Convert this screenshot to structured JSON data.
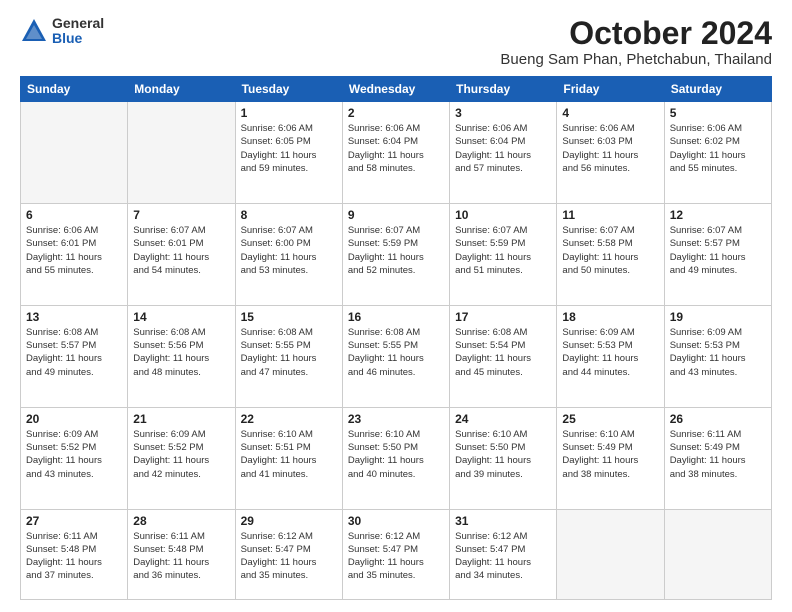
{
  "logo": {
    "general": "General",
    "blue": "Blue"
  },
  "header": {
    "month_title": "October 2024",
    "location": "Bueng Sam Phan, Phetchabun, Thailand"
  },
  "weekdays": [
    "Sunday",
    "Monday",
    "Tuesday",
    "Wednesday",
    "Thursday",
    "Friday",
    "Saturday"
  ],
  "weeks": [
    [
      {
        "day": "",
        "info": ""
      },
      {
        "day": "",
        "info": ""
      },
      {
        "day": "1",
        "info": "Sunrise: 6:06 AM\nSunset: 6:05 PM\nDaylight: 11 hours\nand 59 minutes."
      },
      {
        "day": "2",
        "info": "Sunrise: 6:06 AM\nSunset: 6:04 PM\nDaylight: 11 hours\nand 58 minutes."
      },
      {
        "day": "3",
        "info": "Sunrise: 6:06 AM\nSunset: 6:04 PM\nDaylight: 11 hours\nand 57 minutes."
      },
      {
        "day": "4",
        "info": "Sunrise: 6:06 AM\nSunset: 6:03 PM\nDaylight: 11 hours\nand 56 minutes."
      },
      {
        "day": "5",
        "info": "Sunrise: 6:06 AM\nSunset: 6:02 PM\nDaylight: 11 hours\nand 55 minutes."
      }
    ],
    [
      {
        "day": "6",
        "info": "Sunrise: 6:06 AM\nSunset: 6:01 PM\nDaylight: 11 hours\nand 55 minutes."
      },
      {
        "day": "7",
        "info": "Sunrise: 6:07 AM\nSunset: 6:01 PM\nDaylight: 11 hours\nand 54 minutes."
      },
      {
        "day": "8",
        "info": "Sunrise: 6:07 AM\nSunset: 6:00 PM\nDaylight: 11 hours\nand 53 minutes."
      },
      {
        "day": "9",
        "info": "Sunrise: 6:07 AM\nSunset: 5:59 PM\nDaylight: 11 hours\nand 52 minutes."
      },
      {
        "day": "10",
        "info": "Sunrise: 6:07 AM\nSunset: 5:59 PM\nDaylight: 11 hours\nand 51 minutes."
      },
      {
        "day": "11",
        "info": "Sunrise: 6:07 AM\nSunset: 5:58 PM\nDaylight: 11 hours\nand 50 minutes."
      },
      {
        "day": "12",
        "info": "Sunrise: 6:07 AM\nSunset: 5:57 PM\nDaylight: 11 hours\nand 49 minutes."
      }
    ],
    [
      {
        "day": "13",
        "info": "Sunrise: 6:08 AM\nSunset: 5:57 PM\nDaylight: 11 hours\nand 49 minutes."
      },
      {
        "day": "14",
        "info": "Sunrise: 6:08 AM\nSunset: 5:56 PM\nDaylight: 11 hours\nand 48 minutes."
      },
      {
        "day": "15",
        "info": "Sunrise: 6:08 AM\nSunset: 5:55 PM\nDaylight: 11 hours\nand 47 minutes."
      },
      {
        "day": "16",
        "info": "Sunrise: 6:08 AM\nSunset: 5:55 PM\nDaylight: 11 hours\nand 46 minutes."
      },
      {
        "day": "17",
        "info": "Sunrise: 6:08 AM\nSunset: 5:54 PM\nDaylight: 11 hours\nand 45 minutes."
      },
      {
        "day": "18",
        "info": "Sunrise: 6:09 AM\nSunset: 5:53 PM\nDaylight: 11 hours\nand 44 minutes."
      },
      {
        "day": "19",
        "info": "Sunrise: 6:09 AM\nSunset: 5:53 PM\nDaylight: 11 hours\nand 43 minutes."
      }
    ],
    [
      {
        "day": "20",
        "info": "Sunrise: 6:09 AM\nSunset: 5:52 PM\nDaylight: 11 hours\nand 43 minutes."
      },
      {
        "day": "21",
        "info": "Sunrise: 6:09 AM\nSunset: 5:52 PM\nDaylight: 11 hours\nand 42 minutes."
      },
      {
        "day": "22",
        "info": "Sunrise: 6:10 AM\nSunset: 5:51 PM\nDaylight: 11 hours\nand 41 minutes."
      },
      {
        "day": "23",
        "info": "Sunrise: 6:10 AM\nSunset: 5:50 PM\nDaylight: 11 hours\nand 40 minutes."
      },
      {
        "day": "24",
        "info": "Sunrise: 6:10 AM\nSunset: 5:50 PM\nDaylight: 11 hours\nand 39 minutes."
      },
      {
        "day": "25",
        "info": "Sunrise: 6:10 AM\nSunset: 5:49 PM\nDaylight: 11 hours\nand 38 minutes."
      },
      {
        "day": "26",
        "info": "Sunrise: 6:11 AM\nSunset: 5:49 PM\nDaylight: 11 hours\nand 38 minutes."
      }
    ],
    [
      {
        "day": "27",
        "info": "Sunrise: 6:11 AM\nSunset: 5:48 PM\nDaylight: 11 hours\nand 37 minutes."
      },
      {
        "day": "28",
        "info": "Sunrise: 6:11 AM\nSunset: 5:48 PM\nDaylight: 11 hours\nand 36 minutes."
      },
      {
        "day": "29",
        "info": "Sunrise: 6:12 AM\nSunset: 5:47 PM\nDaylight: 11 hours\nand 35 minutes."
      },
      {
        "day": "30",
        "info": "Sunrise: 6:12 AM\nSunset: 5:47 PM\nDaylight: 11 hours\nand 35 minutes."
      },
      {
        "day": "31",
        "info": "Sunrise: 6:12 AM\nSunset: 5:47 PM\nDaylight: 11 hours\nand 34 minutes."
      },
      {
        "day": "",
        "info": ""
      },
      {
        "day": "",
        "info": ""
      }
    ]
  ]
}
